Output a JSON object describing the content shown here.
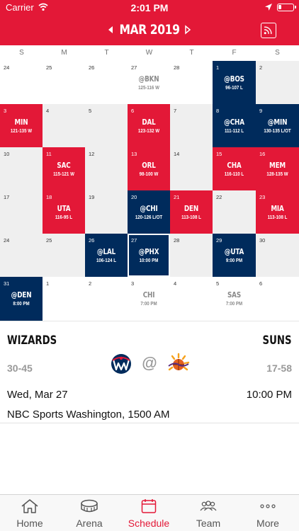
{
  "status_bar": {
    "carrier": "Carrier",
    "time": "2:01 PM"
  },
  "header": {
    "month": "MAR 2019"
  },
  "weekdays": [
    "S",
    "M",
    "T",
    "W",
    "T",
    "F",
    "S"
  ],
  "calendar": [
    {
      "day": "24",
      "opp": "",
      "res": "",
      "style": "white"
    },
    {
      "day": "25",
      "opp": "",
      "res": "",
      "style": "white"
    },
    {
      "day": "26",
      "opp": "",
      "res": "",
      "style": "white"
    },
    {
      "day": "27",
      "opp": "@BKN",
      "res": "125-116 W",
      "style": "white muted"
    },
    {
      "day": "28",
      "opp": "",
      "res": "",
      "style": "white"
    },
    {
      "day": "1",
      "opp": "@BOS",
      "res": "96-107 L",
      "style": "navy"
    },
    {
      "day": "2",
      "opp": "",
      "res": "",
      "style": "gray"
    },
    {
      "day": "3",
      "opp": "MIN",
      "res": "121-135 W",
      "style": "red"
    },
    {
      "day": "4",
      "opp": "",
      "res": "",
      "style": "gray"
    },
    {
      "day": "5",
      "opp": "",
      "res": "",
      "style": "gray"
    },
    {
      "day": "6",
      "opp": "DAL",
      "res": "123-132 W",
      "style": "red"
    },
    {
      "day": "7",
      "opp": "",
      "res": "",
      "style": "gray"
    },
    {
      "day": "8",
      "opp": "@CHA",
      "res": "111-112 L",
      "style": "navy"
    },
    {
      "day": "9",
      "opp": "@MIN",
      "res": "130-135 L/OT",
      "style": "navy"
    },
    {
      "day": "10",
      "opp": "",
      "res": "",
      "style": "gray"
    },
    {
      "day": "11",
      "opp": "SAC",
      "res": "115-121 W",
      "style": "red"
    },
    {
      "day": "12",
      "opp": "",
      "res": "",
      "style": "gray"
    },
    {
      "day": "13",
      "opp": "ORL",
      "res": "98-100 W",
      "style": "red"
    },
    {
      "day": "14",
      "opp": "",
      "res": "",
      "style": "gray"
    },
    {
      "day": "15",
      "opp": "CHA",
      "res": "116-110 L",
      "style": "red"
    },
    {
      "day": "16",
      "opp": "MEM",
      "res": "128-135 W",
      "style": "red"
    },
    {
      "day": "17",
      "opp": "",
      "res": "",
      "style": "gray"
    },
    {
      "day": "18",
      "opp": "UTA",
      "res": "116-95 L",
      "style": "red"
    },
    {
      "day": "19",
      "opp": "",
      "res": "",
      "style": "gray"
    },
    {
      "day": "20",
      "opp": "@CHI",
      "res": "120-126 L/OT",
      "style": "navy"
    },
    {
      "day": "21",
      "opp": "DEN",
      "res": "113-108 L",
      "style": "red"
    },
    {
      "day": "22",
      "opp": "",
      "res": "",
      "style": "gray"
    },
    {
      "day": "23",
      "opp": "MIA",
      "res": "113-108 L",
      "style": "red"
    },
    {
      "day": "24",
      "opp": "",
      "res": "",
      "style": "gray"
    },
    {
      "day": "25",
      "opp": "",
      "res": "",
      "style": "gray"
    },
    {
      "day": "26",
      "opp": "@LAL",
      "res": "106-124 L",
      "style": "navy"
    },
    {
      "day": "27",
      "opp": "@PHX",
      "res": "10:00 PM",
      "style": "navy sel"
    },
    {
      "day": "28",
      "opp": "",
      "res": "",
      "style": "gray"
    },
    {
      "day": "29",
      "opp": "@UTA",
      "res": "9:00 PM",
      "style": "navy"
    },
    {
      "day": "30",
      "opp": "",
      "res": "",
      "style": "gray"
    },
    {
      "day": "31",
      "opp": "@DEN",
      "res": "8:00 PM",
      "style": "navy"
    },
    {
      "day": "1",
      "opp": "",
      "res": "",
      "style": "white"
    },
    {
      "day": "2",
      "opp": "",
      "res": "",
      "style": "white"
    },
    {
      "day": "3",
      "opp": "CHI",
      "res": "7:00 PM",
      "style": "white muted"
    },
    {
      "day": "4",
      "opp": "",
      "res": "",
      "style": "white"
    },
    {
      "day": "5",
      "opp": "SAS",
      "res": "7:00 PM",
      "style": "white muted"
    },
    {
      "day": "6",
      "opp": "",
      "res": "",
      "style": "white"
    }
  ],
  "game": {
    "home_team": "WIZARDS",
    "home_record": "30-45",
    "away_team": "SUNS",
    "away_record": "17-58",
    "at_symbol": "@",
    "date": "Wed, Mar 27",
    "time": "10:00 PM",
    "network": "NBC Sports Washington, 1500 AM"
  },
  "tabs": [
    {
      "label": "Home",
      "icon": "home-icon"
    },
    {
      "label": "Arena",
      "icon": "arena-icon"
    },
    {
      "label": "Schedule",
      "icon": "calendar-icon",
      "active": true
    },
    {
      "label": "Team",
      "icon": "team-icon"
    },
    {
      "label": "More",
      "icon": "more-icon"
    }
  ],
  "colors": {
    "red": "#e31837",
    "navy": "#002b5c",
    "gray": "#efefef"
  }
}
